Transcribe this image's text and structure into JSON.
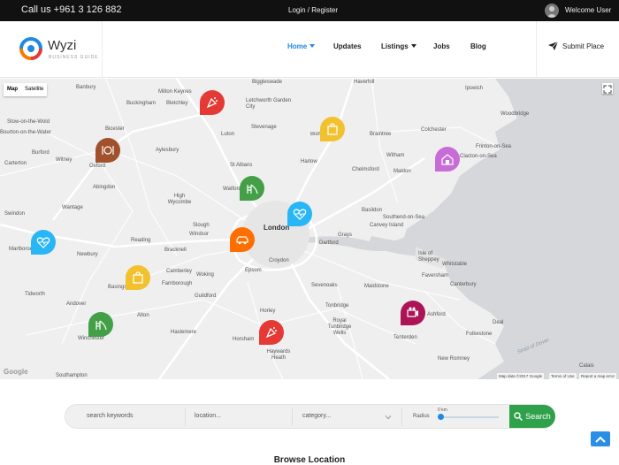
{
  "topbar": {
    "phone": "Call us +961 3 126 882",
    "login": "Login / Register",
    "welcome": "Welcome User"
  },
  "header": {
    "brand": "Wyzi",
    "tagline": "BUSINESS GUIDE",
    "nav": [
      "Home",
      "Updates",
      "Listings",
      "Jobs",
      "Blog"
    ],
    "active_nav": "Home",
    "submit": "Submit Place"
  },
  "map": {
    "type_controls": [
      "Map",
      "Satellite"
    ],
    "google_label": "Google",
    "attribution": [
      "Map data ©2017 Google",
      "Terms of Use",
      "Report a map error"
    ],
    "cities": [
      "Biggleswade",
      "Haverhill",
      "Banbury",
      "Milton Keynes",
      "Ipswich",
      "Buckingham",
      "Bletchley",
      "Letchworth Garden City",
      "Stow-on-the-Wold",
      "Bicester",
      "Stevenage",
      "Woodbridge",
      "Luton",
      "Bishop's Stortford",
      "Braintree",
      "Colchester",
      "Bourton-on-the-Water",
      "Aylesbury",
      "Frinton-on-Sea",
      "Burford",
      "Witney",
      "Oxford",
      "Harlow",
      "Witham",
      "Clacton-on-Sea",
      "Carterton",
      "St Albans",
      "Chelmsford",
      "Maldon",
      "Abingdon",
      "Watford",
      "High Wycombe",
      "Wantage",
      "Basildon",
      "Swindon",
      "Slough",
      "Windsor",
      "Southend-on-Sea",
      "Canvey Island",
      "London",
      "Grays",
      "Reading",
      "Dartford",
      "Marlborough",
      "Newbury",
      "Bracknell",
      "Croydon",
      "Isle of Sheppey",
      "Whitstable",
      "Epsom",
      "Camberley",
      "Farnborough",
      "Woking",
      "Faversham",
      "Sevenoaks",
      "Basingstoke",
      "Maidstone",
      "Canterbury",
      "Tidworth",
      "Guildford",
      "Andover",
      "Alton",
      "Tonbridge",
      "Royal Tunbridge Wells",
      "Ashford",
      "Horley",
      "Deal",
      "Haslemere",
      "Horsham",
      "Winchester",
      "Tenterden",
      "Folkestone",
      "Haywards Heath",
      "New Romney",
      "Southampton",
      "Calais",
      "Strait of Dover"
    ],
    "markers": [
      {
        "icon": "party-icon",
        "color": "#e53935"
      },
      {
        "icon": "shopping-bag-icon",
        "color": "#f2c12e"
      },
      {
        "icon": "restaurant-icon",
        "color": "#a0522d"
      },
      {
        "icon": "house-icon",
        "color": "#c86dd7"
      },
      {
        "icon": "slide-icon",
        "color": "#43a047"
      },
      {
        "icon": "heart-pulse-icon",
        "color": "#29b6f6"
      },
      {
        "icon": "taxi-icon",
        "color": "#ff6f00"
      },
      {
        "icon": "heart-pulse-icon",
        "color": "#29b6f6"
      },
      {
        "icon": "shopping-bag-icon",
        "color": "#f2c12e"
      },
      {
        "icon": "slide-icon",
        "color": "#43a047"
      },
      {
        "icon": "party-icon",
        "color": "#e53935"
      },
      {
        "icon": "camera-icon",
        "color": "#ad1457"
      }
    ]
  },
  "search": {
    "keywords_placeholder": "search keywords",
    "location_placeholder": "location...",
    "category_placeholder": "category...",
    "radius_label": "Radius",
    "radius_value": "0 km",
    "radius_level_km": 0,
    "button": "Search"
  },
  "section_title": "Browse Location",
  "colors": {
    "accent": "#1e88e5",
    "search_button": "#2fa14b",
    "topbar": "#111111"
  }
}
